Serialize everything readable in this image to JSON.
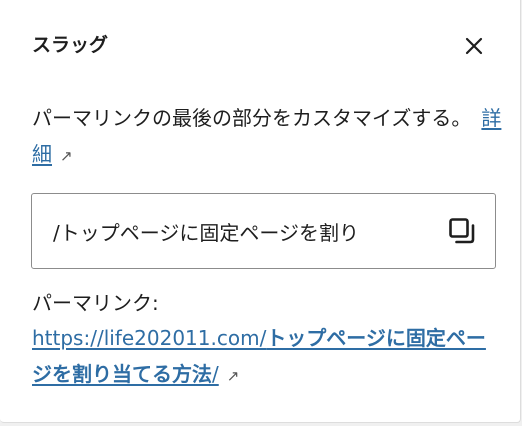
{
  "panel": {
    "title": "スラッグ",
    "close_icon": "close-icon"
  },
  "description": {
    "text": "パーマリンクの最後の部分をカスタマイズする。",
    "learn_more": "詳細",
    "external_icon": "↗"
  },
  "slug_field": {
    "value": "/トップページに固定ページを割り",
    "copy_icon": "copy-icon"
  },
  "permalink": {
    "label": "パーマリンク:",
    "base": "https://life202011.com/",
    "slug": "トップページに固定ページを割り当てる方法",
    "trailing": "/",
    "external_icon": "↗"
  }
}
